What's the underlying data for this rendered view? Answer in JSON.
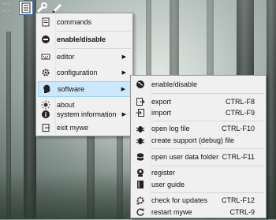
{
  "toolbar": {
    "prompt_1": ">>>",
    "prompt_2": ">>>",
    "icons": [
      "document-list-icon",
      "wrench-icon",
      "pencil-icon"
    ]
  },
  "main_menu": {
    "items": [
      {
        "label": "commands",
        "icon": "document-icon"
      },
      {
        "label": "enable/disable",
        "icon": "stop-icon",
        "bold": true
      },
      {
        "label": "editor",
        "icon": "keyboard-icon",
        "submenu": true
      },
      {
        "label": "configuration",
        "icon": "gear-icon",
        "submenu": true
      },
      {
        "label": "software",
        "icon": "head-icon",
        "submenu": true,
        "highlighted": true
      },
      {
        "label": "about",
        "icon": "sun-icon"
      },
      {
        "label": "system information",
        "icon": "info-icon",
        "submenu": true
      },
      {
        "label": "exit mywe",
        "icon": "exit-icon"
      }
    ]
  },
  "software_menu": {
    "items": [
      {
        "label": "enable/disable",
        "icon": "globe-icon",
        "shortcut": ""
      },
      {
        "label": "export",
        "icon": "export-icon",
        "shortcut": "CTRL-F8"
      },
      {
        "label": "import",
        "icon": "import-icon",
        "shortcut": "CTRL-F9"
      },
      {
        "label": "open log file",
        "icon": "bug-icon",
        "shortcut": "CTRL-F10"
      },
      {
        "label": "create support (debug) file",
        "icon": "bug-icon",
        "shortcut": ""
      },
      {
        "label": "open user data folder",
        "icon": "database-icon",
        "shortcut": "CTRL-F11"
      },
      {
        "label": "register",
        "icon": "register-icon",
        "shortcut": ""
      },
      {
        "label": "user guide",
        "icon": "book-icon",
        "shortcut": ""
      },
      {
        "label": "check for updates",
        "icon": "update-gear-icon",
        "shortcut": "CTRL-F12"
      },
      {
        "label": "restart mywe",
        "icon": "restart-icon",
        "shortcut": "CTRL-9"
      }
    ]
  },
  "colors": {
    "highlight": "#cce8ff",
    "highlight_border": "#99d1ff",
    "menu_bg": "#f0f0f0"
  }
}
